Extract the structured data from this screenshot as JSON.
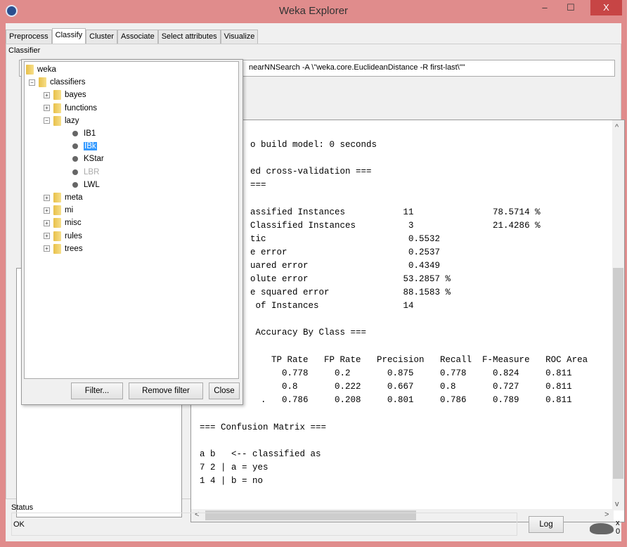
{
  "window": {
    "title": "Weka Explorer",
    "minimize": "–",
    "maximize": "☐",
    "close": "X"
  },
  "tabs": [
    {
      "label": "Preprocess"
    },
    {
      "label": "Classify"
    },
    {
      "label": "Cluster"
    },
    {
      "label": "Associate"
    },
    {
      "label": "Select attributes"
    },
    {
      "label": "Visualize"
    }
  ],
  "classifier": {
    "group_label": "Classifier",
    "value": "nearNNSearch -A \\\"weka.core.EuclideanDistance -R first-last\\\"\""
  },
  "tree": {
    "root": "weka",
    "classifiers": "classifiers",
    "folders_before": [
      "bayes",
      "functions"
    ],
    "lazy": "lazy",
    "lazy_items": [
      {
        "label": "IB1"
      },
      {
        "label": "IBk",
        "selected": true
      },
      {
        "label": "KStar"
      },
      {
        "label": "LBR",
        "disabled": true
      },
      {
        "label": "LWL"
      }
    ],
    "folders_after": [
      "meta",
      "mi",
      "misc",
      "rules",
      "trees"
    ],
    "buttons": {
      "filter": "Filter...",
      "remove_filter": "Remove filter",
      "close": "Close"
    }
  },
  "output": {
    "lines": [
      "o build model: 0 seconds",
      "",
      "ed cross-validation ===",
      "===",
      "",
      "assified Instances           11               78.5714 %",
      "Classified Instances          3               21.4286 %",
      "tic                           0.5532",
      "e error                       0.2537",
      "uared error                   0.4349",
      "olute error                  53.2857 %",
      "e squared error              88.1583 %",
      " of Instances                14",
      "",
      " Accuracy By Class ===",
      "",
      "    TP Rate   FP Rate   Precision   Recall  F-Measure   ROC Area",
      "      0.778     0.2       0.875     0.778     0.824     0.811",
      "      0.8       0.222     0.667     0.8       0.727     0.811",
      "  .   0.786     0.208     0.801     0.786     0.789     0.811"
    ],
    "lower_lines": [
      "=== Confusion Matrix ===",
      "",
      "a b   <-- classified as",
      "7 2 | a = yes",
      "1 4 | b = no"
    ]
  },
  "status": {
    "label": "Status",
    "text": "OK",
    "log_button": "Log",
    "count": "x 0"
  }
}
